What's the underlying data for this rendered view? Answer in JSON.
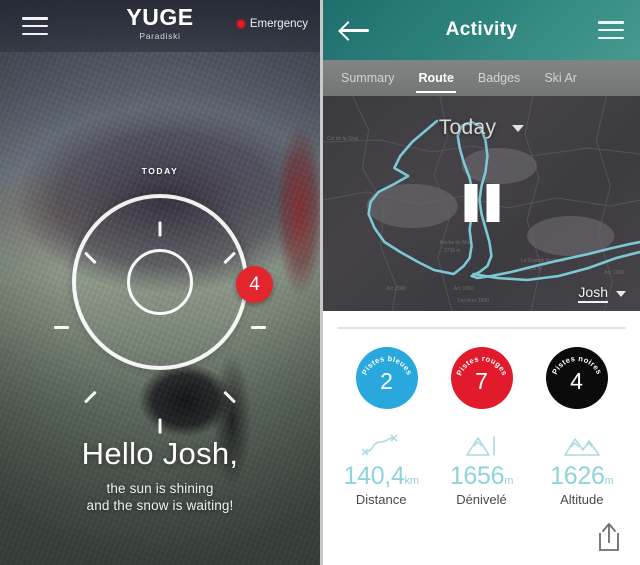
{
  "left_panel": {
    "menu_icon": "hamburger-menu-icon",
    "brand": {
      "name": "YUGE",
      "subtitle": "Paradiski"
    },
    "emergency": {
      "label": "Emergency",
      "dot_color": "#e01b22"
    },
    "today_label": "TODAY",
    "weather_icon": "sun-icon",
    "notification_badge": "4",
    "greeting": {
      "title": "Hello Josh,",
      "line1": "the sun is shining",
      "line2": "and the snow is waiting!"
    }
  },
  "right_panel": {
    "back_icon": "back-arrow-icon",
    "title": "Activity",
    "menu_icon": "hamburger-menu-icon",
    "tabs": [
      {
        "label": "Summary",
        "active": false
      },
      {
        "label": "Route",
        "active": true
      },
      {
        "label": "Badges",
        "active": false
      },
      {
        "label": "Ski Ar",
        "active": false
      }
    ],
    "map": {
      "date_filter": "Today",
      "date_caret_icon": "chevron-down-icon",
      "playback_icon": "pause-icon",
      "user_filter": "Josh",
      "user_caret_icon": "chevron-down-icon",
      "route_color": "#7cc8d4"
    },
    "pistes": [
      {
        "label": "Pistes bleues",
        "value": "2",
        "color": "#29a8dd"
      },
      {
        "label": "Pistes rouges",
        "value": "7",
        "color": "#e11b2c"
      },
      {
        "label": "Pistes noires",
        "value": "4",
        "color": "#0b0b0b"
      }
    ],
    "stats": [
      {
        "icon": "route-path-icon",
        "value": "140,4",
        "unit": "km",
        "label": "Distance"
      },
      {
        "icon": "mountain-peak-icon",
        "value": "1656",
        "unit": "m",
        "label": "Dénivelé"
      },
      {
        "icon": "mountain-range-icon",
        "value": "1626",
        "unit": "m",
        "label": "Altitude"
      }
    ],
    "share_icon": "share-icon",
    "accent_color": "#8fd4db",
    "header_color": "#2b7f79"
  }
}
